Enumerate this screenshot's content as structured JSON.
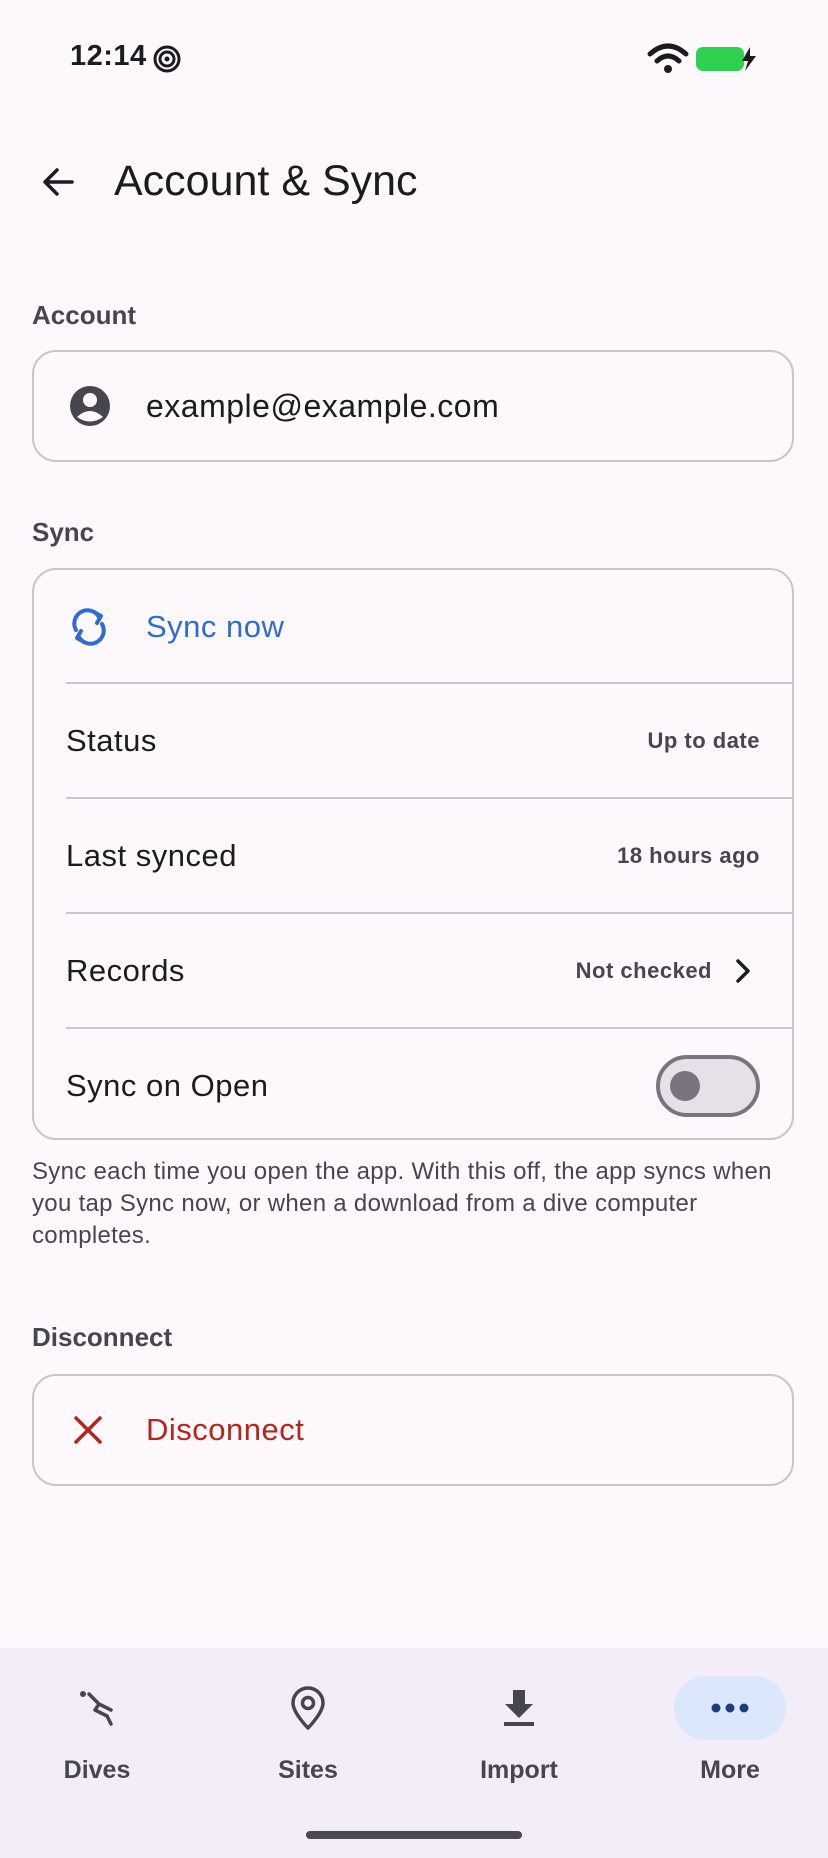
{
  "status_bar": {
    "time": "12:14"
  },
  "app_bar": {
    "title": "Account & Sync"
  },
  "account": {
    "section_label": "Account",
    "email": "example@example.com"
  },
  "sync": {
    "section_label": "Sync",
    "sync_now_label": "Sync now",
    "status_label": "Status",
    "status_value": "Up to date",
    "last_synced_label": "Last synced",
    "last_synced_value": "18 hours ago",
    "records_label": "Records",
    "records_value": "Not checked",
    "sync_on_open_label": "Sync on Open",
    "sync_on_open_enabled": false,
    "help_text": "Sync each time you open the app. With this off, the app syncs when you tap Sync now, or when a download from a dive computer completes."
  },
  "disconnect": {
    "section_label": "Disconnect",
    "button_label": "Disconnect"
  },
  "bottom_nav": {
    "items": [
      {
        "label": "Dives",
        "icon": "dive-icon",
        "active": false
      },
      {
        "label": "Sites",
        "icon": "location-pin-icon",
        "active": false
      },
      {
        "label": "Import",
        "icon": "download-icon",
        "active": false
      },
      {
        "label": "More",
        "icon": "more-horizontal-icon",
        "active": true
      }
    ]
  },
  "colors": {
    "background": "#fdf8fc",
    "accent_blue": "#2f6bd0",
    "danger_red": "#b3261e",
    "nav_background": "#f3edf7",
    "nav_active_pill": "#dbe7fb",
    "battery_green": "#2fd04f"
  }
}
